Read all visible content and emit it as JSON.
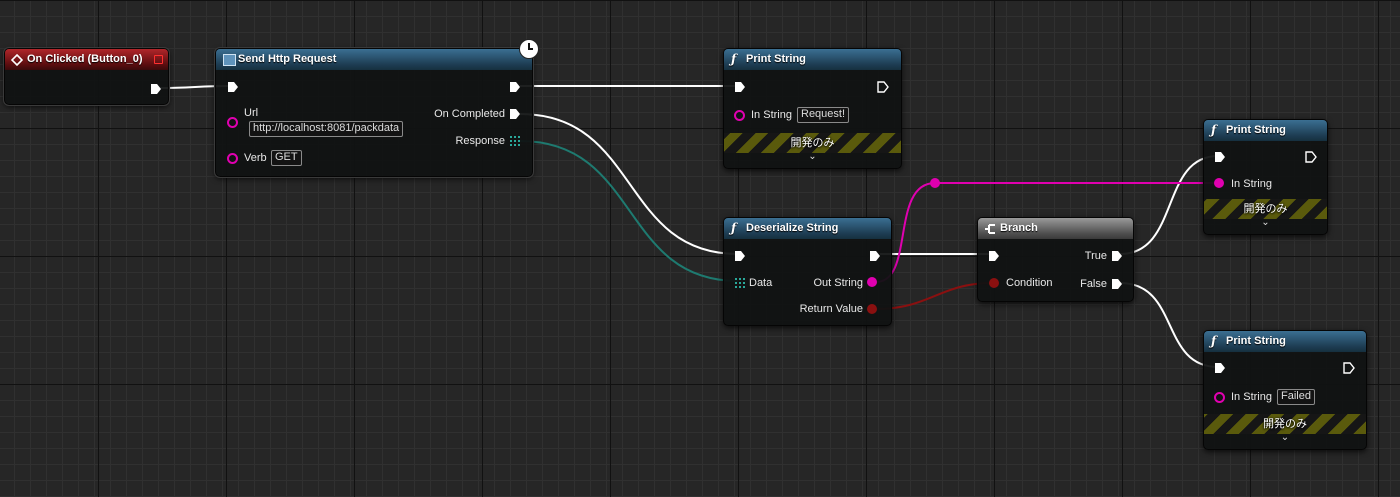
{
  "nodes": {
    "on_clicked": {
      "title": "On Clicked (Button_0)"
    },
    "http": {
      "title": "Send Http Request",
      "url_label": "Url",
      "url_value": "http://localhost:8081/packdata",
      "verb_label": "Verb",
      "verb_value": "GET",
      "on_completed_label": "On Completed",
      "response_label": "Response"
    },
    "print1": {
      "title": "Print String",
      "in_string_label": "In String",
      "in_string_value": "Request!",
      "dev_only": "開発のみ"
    },
    "deserialize": {
      "title": "Deserialize String",
      "data_label": "Data",
      "out_string_label": "Out String",
      "return_value_label": "Return Value"
    },
    "branch": {
      "title": "Branch",
      "condition_label": "Condition",
      "true_label": "True",
      "false_label": "False"
    },
    "print2": {
      "title": "Print String",
      "in_string_label": "In String",
      "dev_only": "開発のみ"
    },
    "print3": {
      "title": "Print String",
      "in_string_label": "In String",
      "in_string_value": "Failed",
      "dev_only": "開発のみ"
    }
  },
  "colors": {
    "exec_wire": "#ffffff",
    "string_wire": "#e000b0",
    "bool_wire": "#8a1010",
    "struct_wire": "#1e7a70"
  },
  "icons": {
    "event": "diamond-event-icon",
    "function": "function-f-icon",
    "branch": "branch-icon",
    "latent": "clock-icon",
    "http": "http-node-icon"
  }
}
